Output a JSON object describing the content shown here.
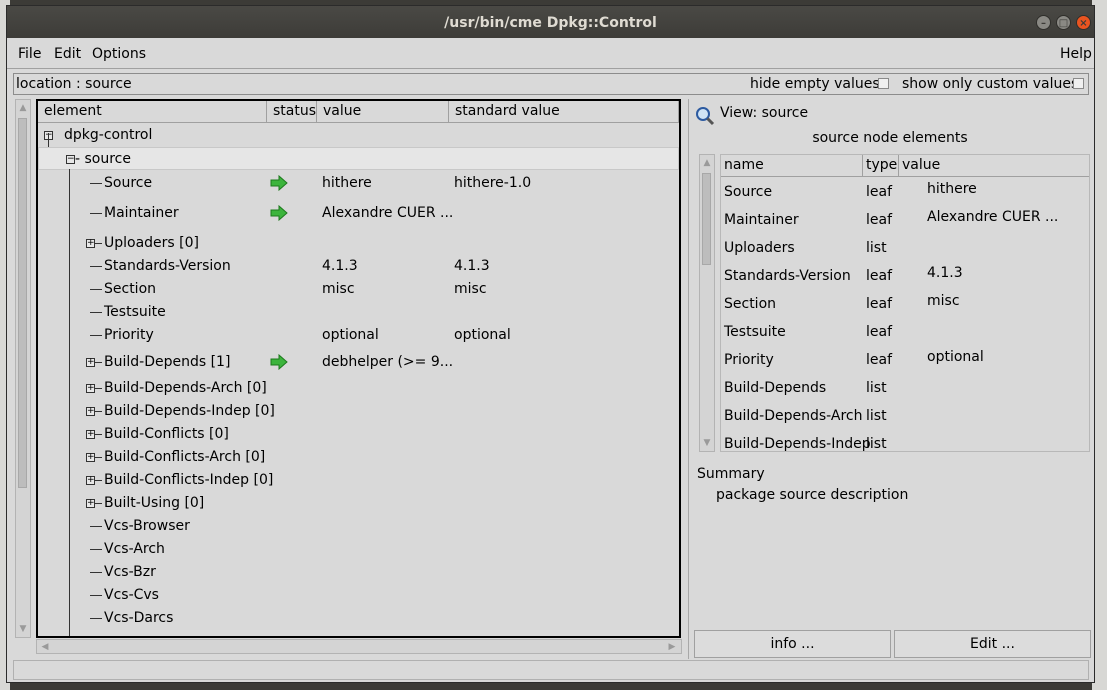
{
  "window": {
    "title": "/usr/bin/cme Dpkg::Control"
  },
  "menubar": {
    "file": "File",
    "edit": "Edit",
    "options": "Options",
    "help": "Help"
  },
  "location": {
    "text": "location : source",
    "hide_empty_values": "hide empty values",
    "show_only_custom_values": "show only custom values"
  },
  "tree": {
    "columns": {
      "element": "element",
      "status": "status",
      "value": "value",
      "standard_value": "standard value"
    },
    "root": "dpkg-control",
    "source": "- source",
    "rows": [
      {
        "name": "Source",
        "value": "hithere",
        "standard": "hithere-1.0",
        "status": "green-arrow-icon",
        "expand": false
      },
      {
        "name": "Maintainer",
        "value": "Alexandre CUER ...",
        "standard": "",
        "status": "green-arrow-icon",
        "expand": false
      },
      {
        "name": "Uploaders [0]",
        "value": "",
        "standard": "",
        "status": "",
        "expand": true
      },
      {
        "name": "Standards-Version",
        "value": "4.1.3",
        "standard": "4.1.3",
        "status": "",
        "expand": false
      },
      {
        "name": "Section",
        "value": "misc",
        "standard": "misc",
        "status": "",
        "expand": false
      },
      {
        "name": "Testsuite",
        "value": "",
        "standard": "",
        "status": "",
        "expand": false
      },
      {
        "name": "Priority",
        "value": "optional",
        "standard": "optional",
        "status": "",
        "expand": false
      },
      {
        "name": "Build-Depends [1]",
        "value": "debhelper (>= 9...",
        "standard": "",
        "status": "green-arrow-icon",
        "expand": true
      },
      {
        "name": "Build-Depends-Arch [0]",
        "value": "",
        "standard": "",
        "status": "",
        "expand": true
      },
      {
        "name": "Build-Depends-Indep [0]",
        "value": "",
        "standard": "",
        "status": "",
        "expand": true
      },
      {
        "name": "Build-Conflicts [0]",
        "value": "",
        "standard": "",
        "status": "",
        "expand": true
      },
      {
        "name": "Build-Conflicts-Arch [0]",
        "value": "",
        "standard": "",
        "status": "",
        "expand": true
      },
      {
        "name": "Build-Conflicts-Indep [0]",
        "value": "",
        "standard": "",
        "status": "",
        "expand": true
      },
      {
        "name": "Built-Using [0]",
        "value": "",
        "standard": "",
        "status": "",
        "expand": true
      },
      {
        "name": "Vcs-Browser",
        "value": "",
        "standard": "",
        "status": "",
        "expand": false
      },
      {
        "name": "Vcs-Arch",
        "value": "",
        "standard": "",
        "status": "",
        "expand": false
      },
      {
        "name": "Vcs-Bzr",
        "value": "",
        "standard": "",
        "status": "",
        "expand": false
      },
      {
        "name": "Vcs-Cvs",
        "value": "",
        "standard": "",
        "status": "",
        "expand": false
      },
      {
        "name": "Vcs-Darcs",
        "value": "",
        "standard": "",
        "status": "",
        "expand": false
      }
    ]
  },
  "view": {
    "title": "View: source",
    "subtitle": "source node elements",
    "columns": {
      "name": "name",
      "type": "type",
      "value": "value"
    },
    "rows": [
      {
        "name": "Source",
        "type": "leaf",
        "value": "hithere"
      },
      {
        "name": "Maintainer",
        "type": "leaf",
        "value": "Alexandre CUER ..."
      },
      {
        "name": "Uploaders",
        "type": "list",
        "value": ""
      },
      {
        "name": "Standards-Version",
        "type": "leaf",
        "value": "4.1.3"
      },
      {
        "name": "Section",
        "type": "leaf",
        "value": "misc"
      },
      {
        "name": "Testsuite",
        "type": "leaf",
        "value": ""
      },
      {
        "name": "Priority",
        "type": "leaf",
        "value": "optional"
      },
      {
        "name": "Build-Depends",
        "type": "list",
        "value": ""
      },
      {
        "name": "Build-Depends-Arch",
        "type": "list",
        "value": ""
      },
      {
        "name": "Build-Depends-Indep",
        "type": "list",
        "value": ""
      }
    ],
    "summary_label": "Summary",
    "summary_text": "package source description",
    "info_button": "info ...",
    "edit_button": "Edit ..."
  }
}
